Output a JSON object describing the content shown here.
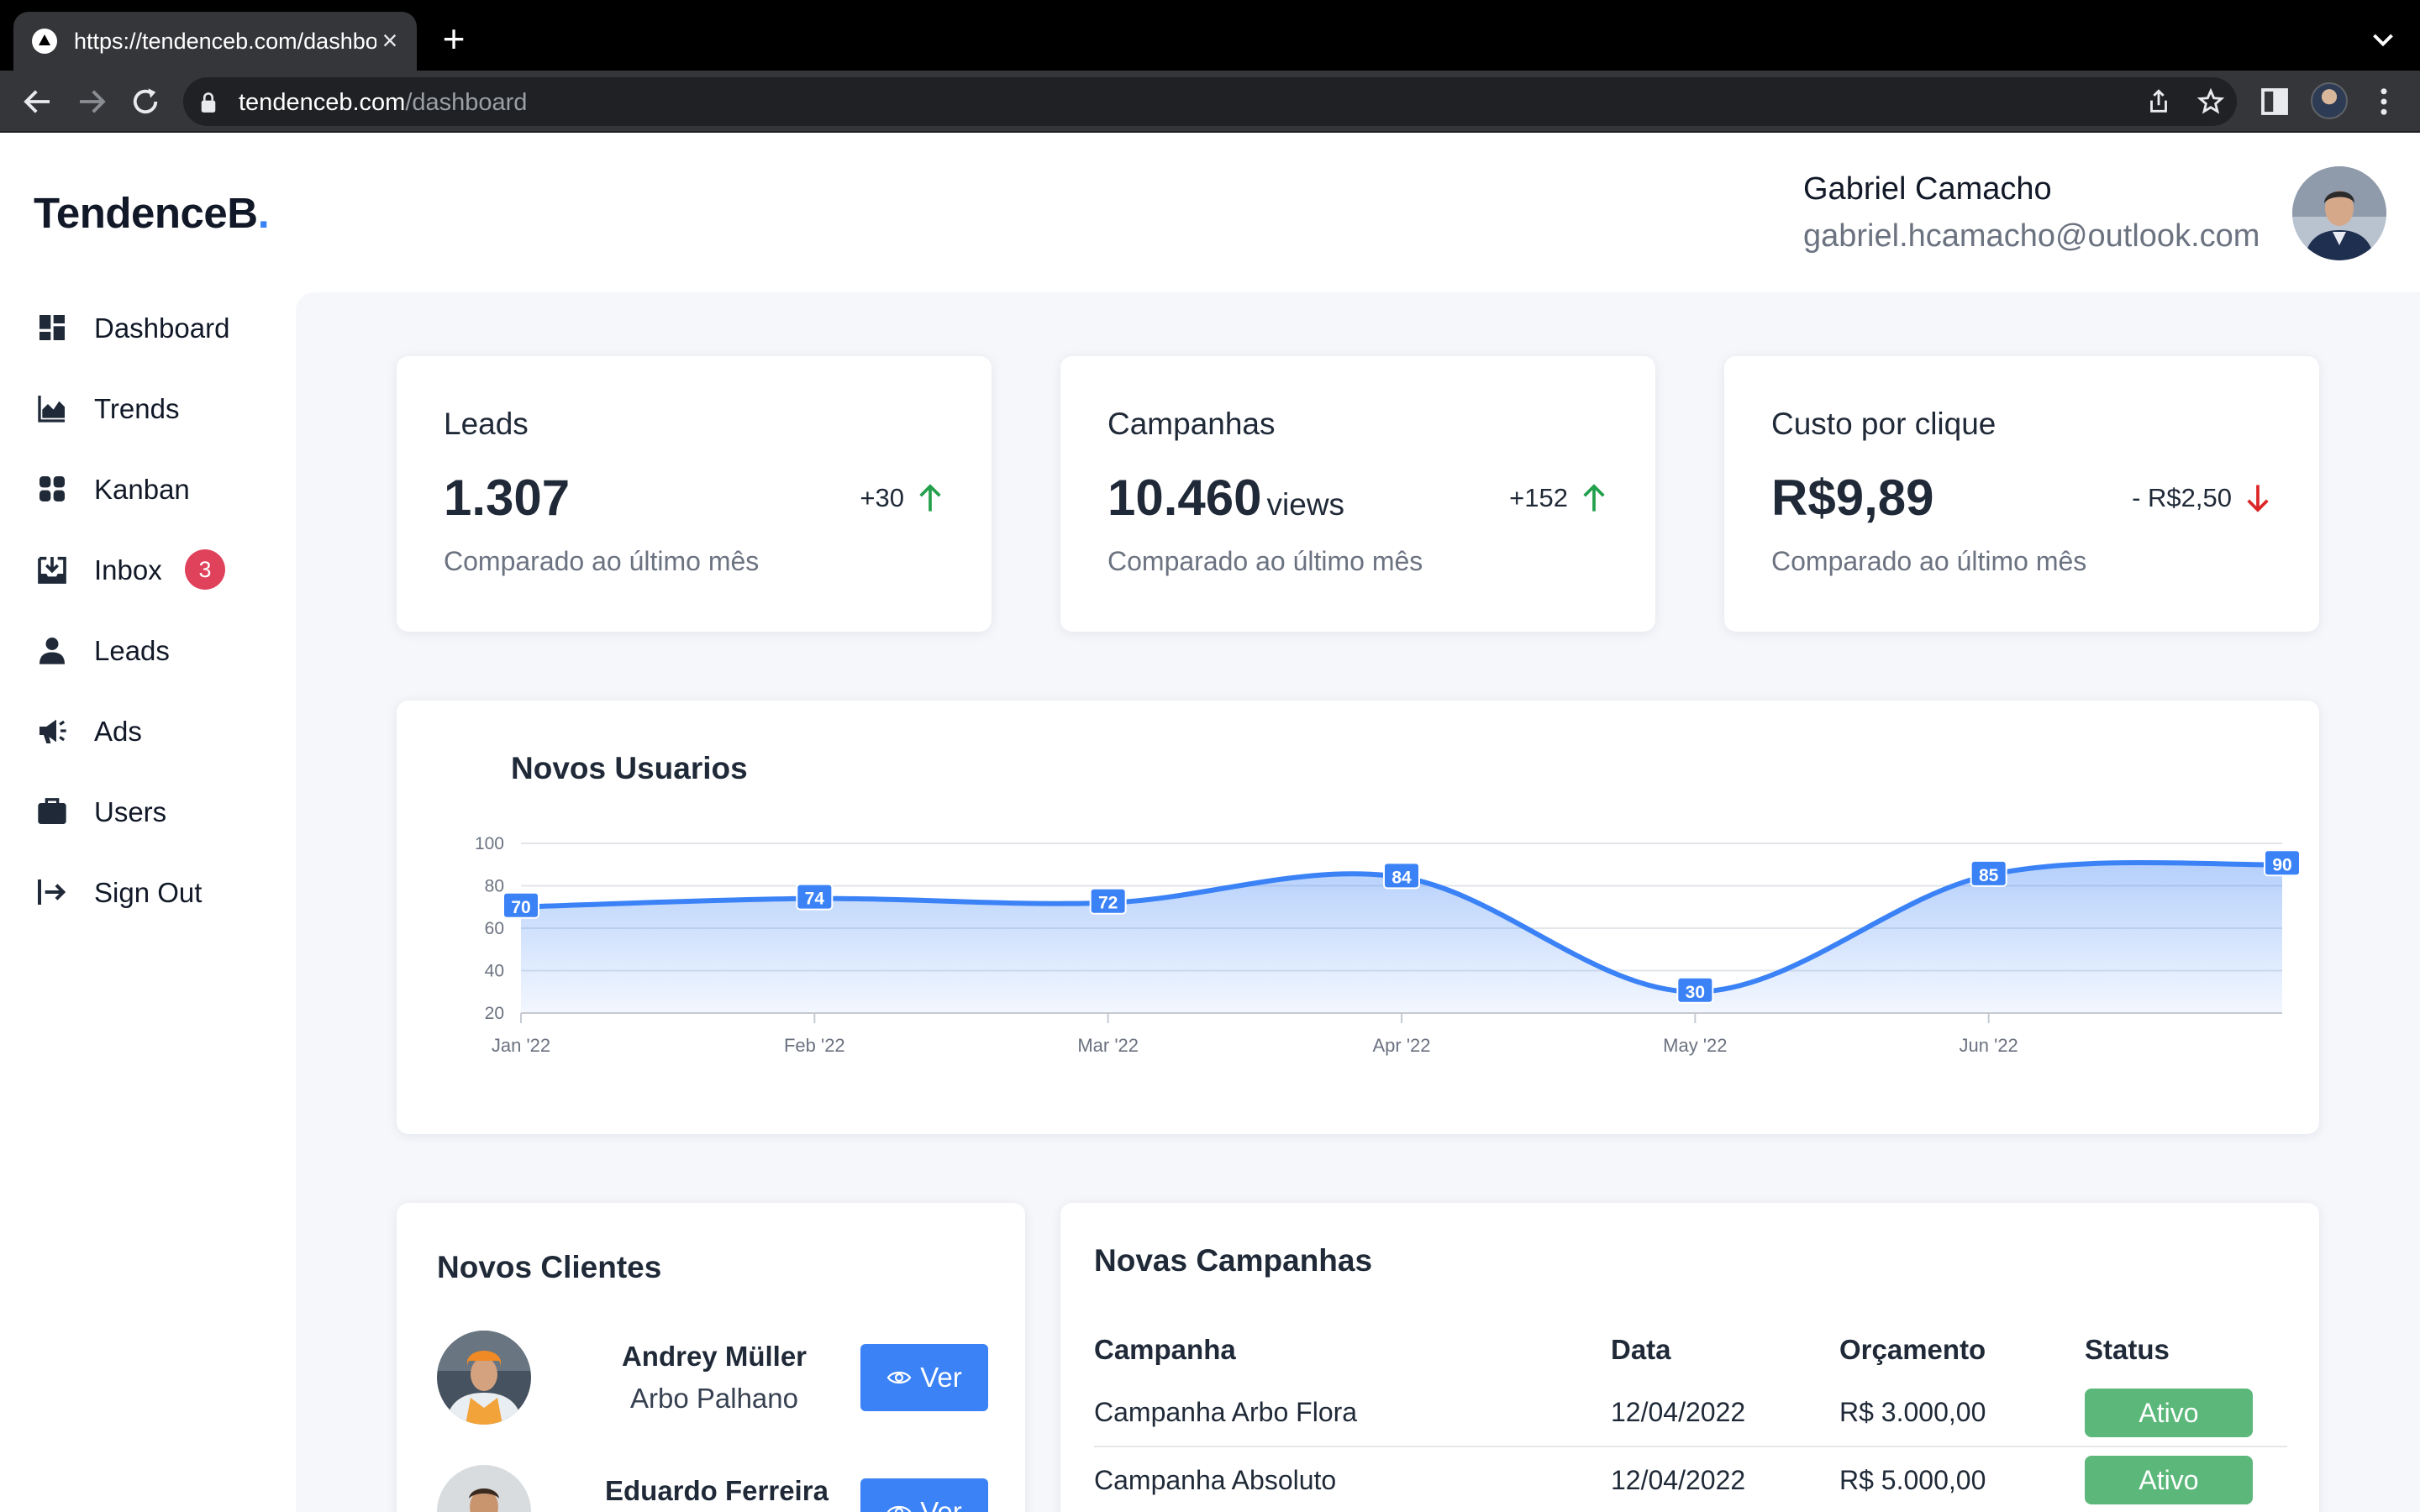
{
  "browser": {
    "tab_title": "https://tendenceb.com/dashboard",
    "url_domain": "tendenceb.com",
    "url_path": "/dashboard"
  },
  "app": {
    "logo_text": "TendenceB",
    "logo_dot": ".",
    "accent_color": "#3b82f6"
  },
  "user": {
    "name": "Gabriel Camacho",
    "email": "gabriel.hcamacho@outlook.com"
  },
  "sidebar": {
    "items": [
      {
        "label": "Dashboard",
        "icon": "dashboard-icon"
      },
      {
        "label": "Trends",
        "icon": "area-chart-icon"
      },
      {
        "label": "Kanban",
        "icon": "grid-icon"
      },
      {
        "label": "Inbox",
        "icon": "inbox-icon",
        "badge": "3"
      },
      {
        "label": "Leads",
        "icon": "person-icon"
      },
      {
        "label": "Ads",
        "icon": "megaphone-icon"
      },
      {
        "label": "Users",
        "icon": "briefcase-icon"
      },
      {
        "label": "Sign Out",
        "icon": "sign-out-icon"
      }
    ]
  },
  "stats": [
    {
      "title": "Leads",
      "value": "1.307",
      "unit": "",
      "delta": "+30",
      "trend": "up",
      "subtitle": "Comparado ao último mês"
    },
    {
      "title": "Campanhas",
      "value": "10.460",
      "unit": "views",
      "delta": "+152",
      "trend": "up",
      "subtitle": "Comparado ao último mês"
    },
    {
      "title": "Custo por clique",
      "value": "R$9,89",
      "unit": "",
      "delta": "- R$2,50",
      "trend": "down",
      "subtitle": "Comparado ao último mês"
    }
  ],
  "trend_colors": {
    "up": "#22a04b",
    "down": "#dc2626"
  },
  "chart_data": {
    "type": "area",
    "title": "Novos Usuarios",
    "x": [
      "Jan '22",
      "Feb '22",
      "Mar '22",
      "Apr '22",
      "May '22",
      "Jun '22",
      ""
    ],
    "xticks": [
      "Jan '22",
      "Feb '22",
      "Mar '22",
      "Apr '22",
      "May '22",
      "Jun '22"
    ],
    "values": [
      70,
      74,
      72,
      84,
      30,
      85,
      90
    ],
    "yticks": [
      100,
      80,
      60,
      40,
      20
    ],
    "ylim": [
      20,
      100
    ],
    "grid": true,
    "color": "#3b82f6"
  },
  "clients": {
    "title": "Novos Clientes",
    "view_label": "Ver",
    "items": [
      {
        "name": "Andrey Müller",
        "company": "Arbo Palhano"
      },
      {
        "name": "Eduardo Ferreira",
        "company": ""
      }
    ]
  },
  "campaigns": {
    "title": "Novas Campanhas",
    "headers": [
      "Campanha",
      "Data",
      "Orçamento",
      "Status"
    ],
    "rows": [
      {
        "name": "Campanha Arbo Flora",
        "date": "12/04/2022",
        "budget": "R$ 3.000,00",
        "status": "Ativo"
      },
      {
        "name": "Campanha Absoluto",
        "date": "12/04/2022",
        "budget": "R$ 5.000,00",
        "status": "Ativo"
      }
    ],
    "status_color": "#5cb87a"
  }
}
